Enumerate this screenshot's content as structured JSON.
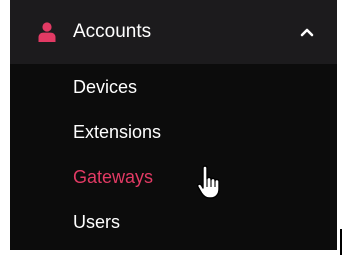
{
  "accounts_menu": {
    "header": {
      "label": "Accounts",
      "icon": "user-icon",
      "expanded": true,
      "chevron_icon": "chevron-up-icon"
    },
    "items": [
      {
        "label": "Devices",
        "active": false
      },
      {
        "label": "Extensions",
        "active": false
      },
      {
        "label": "Gateways",
        "active": true
      },
      {
        "label": "Users",
        "active": false
      }
    ]
  },
  "colors": {
    "active_accent": "#e23a64",
    "menu_background": "#0c0c0c",
    "header_background": "#1c1b1d",
    "text": "#ffffff"
  },
  "cursor": "hand-pointer-icon"
}
